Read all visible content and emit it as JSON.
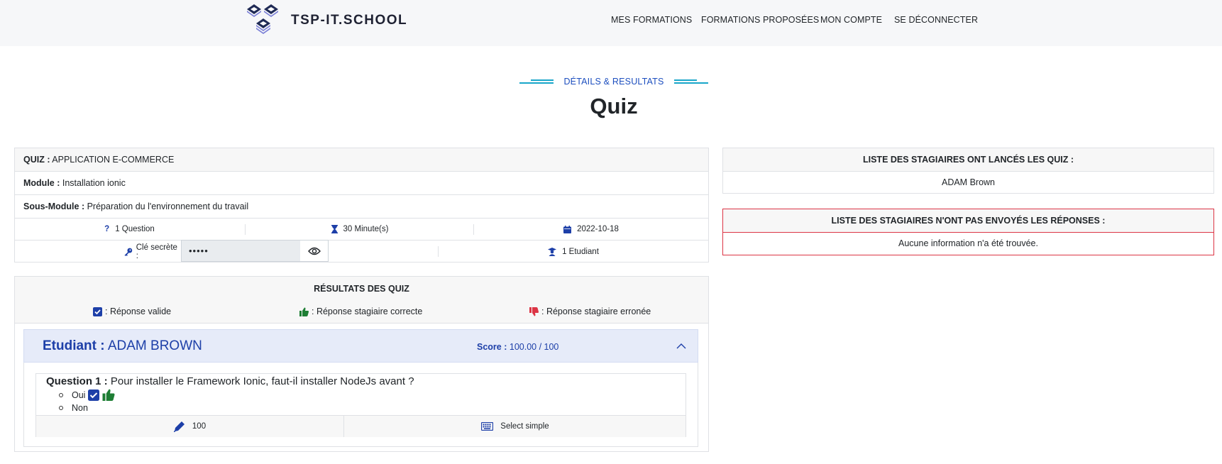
{
  "brand": "TSP-IT.SCHOOL",
  "nav": [
    "MES FORMATIONS",
    "FORMATIONS PROPOSÉES",
    "MON COMPTE",
    "SE DÉCONNECTER"
  ],
  "section_subtitle": "DÉTAILS & RESULTATS",
  "page_title": "Quiz",
  "quiz_info": {
    "quiz_label": "QUIZ :",
    "quiz_value": "APPLICATION E-COMMERCE",
    "module_label": "Module :",
    "module_value": "Installation ionic",
    "sous_module_label": "Sous-Module :",
    "sous_module_value": "Préparation du l'environnement du travail",
    "questions": "1 Question",
    "duration": "30 Minute(s)",
    "date": "2022-10-18",
    "secret_key_label": "Clé secrète :",
    "secret_key_value": "•••••",
    "students": "1 Etudiant"
  },
  "launched_list": {
    "heading": "LISTE DES STAGIAIRES ONT LANCÉS LES QUIZ :",
    "items": [
      "ADAM Brown"
    ]
  },
  "not_sent_list": {
    "heading": "LISTE DES STAGIAIRES N'ONT PAS ENVOYÉS LES RÉPONSES :",
    "empty_message": "Aucune information n'a été trouvée."
  },
  "results": {
    "heading": "RÉSULTATS DES QUIZ",
    "legend": [
      {
        "icon": "check-square-icon",
        "text": ": Réponse valide"
      },
      {
        "icon": "thumbs-up-icon",
        "text": ": Réponse stagiaire correcte"
      },
      {
        "icon": "thumbs-down-icon",
        "text": ": Réponse stagiaire erronée"
      }
    ],
    "student_label": "Etudiant :",
    "student_name": "ADAM BROWN",
    "score_label": "Score :",
    "score_value": "100.00 / 100",
    "question": {
      "label": "Question 1 :",
      "text": "Pour installer le Framework Ionic, faut-il installer NodeJs avant ?",
      "options": [
        "Oui",
        "Non"
      ],
      "points": "100",
      "type": "Select simple"
    }
  },
  "colors": {
    "accent": "#1d3fa8",
    "success": "#1e7e34",
    "danger": "#dc3545",
    "teal": "#19a6c9"
  }
}
